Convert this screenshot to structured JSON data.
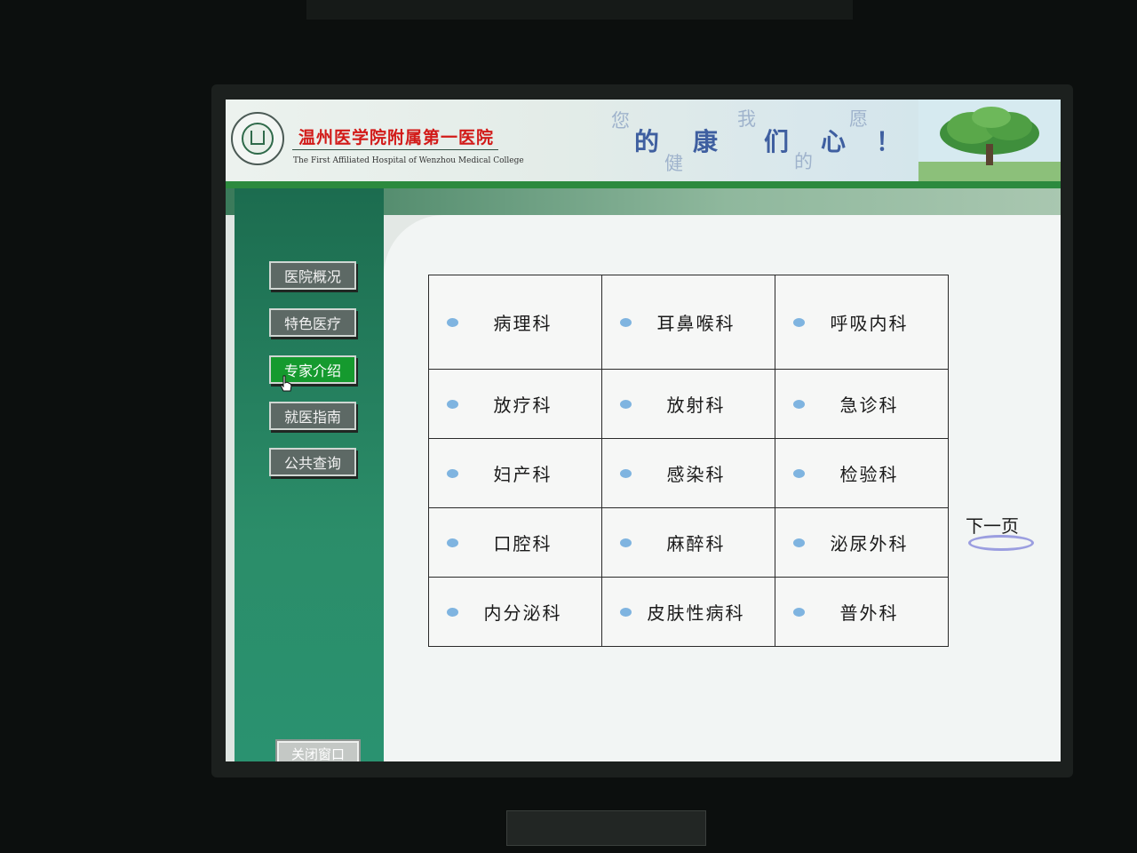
{
  "header": {
    "hospital_name_cn": "温州医学院附属第一医院",
    "hospital_name_en": "The First Affiliated Hospital of Wenzhou Medical College",
    "slogan": [
      "您",
      "的",
      "健",
      "康",
      "我",
      "们",
      "的",
      "心",
      "愿",
      "！"
    ]
  },
  "sidebar": {
    "items": [
      {
        "label": "医院概况"
      },
      {
        "label": "特色医疗"
      },
      {
        "label": "专家介绍",
        "active": true
      },
      {
        "label": "就医指南"
      },
      {
        "label": "公共查询"
      }
    ],
    "close_label": "关闭窗口"
  },
  "departments": [
    [
      "病理科",
      "耳鼻喉科",
      "呼吸内科"
    ],
    [
      "放疗科",
      "放射科",
      "急诊科"
    ],
    [
      "妇产科",
      "感染科",
      "检验科"
    ],
    [
      "口腔科",
      "麻醉科",
      "泌尿外科"
    ],
    [
      "内分泌科",
      "皮肤性病科",
      "普外科"
    ]
  ],
  "next_page_label": "下一页",
  "colors": {
    "accent_active": "#159a2e",
    "title_red": "#d21a18",
    "bullet": "#7fb4e0"
  }
}
